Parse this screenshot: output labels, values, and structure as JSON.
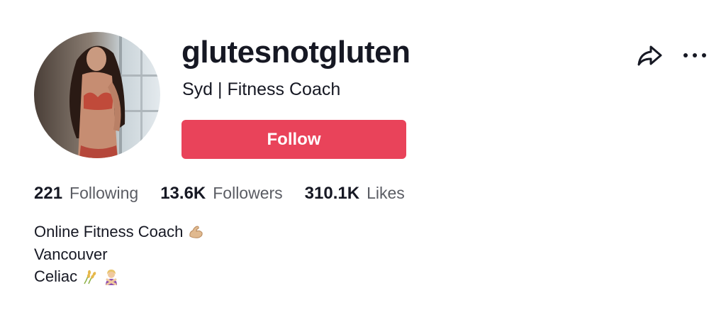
{
  "profile": {
    "username": "glutesnotgluten",
    "nickname": "Syd | Fitness Coach",
    "follow_label": "Follow"
  },
  "stats": [
    {
      "value": "221",
      "label": "Following"
    },
    {
      "value": "13.6K",
      "label": "Followers"
    },
    {
      "value": "310.1K",
      "label": "Likes"
    }
  ],
  "bio": {
    "line1": "Online Fitness Coach",
    "line1_emoji": "flexed-biceps-emoji",
    "line2": "Vancouver",
    "line3": "Celiac",
    "line3_emojis": [
      "wheat-emoji",
      "person-gesturing-no-emoji"
    ]
  },
  "colors": {
    "accent": "#e9435a",
    "text": "#161823",
    "secondary_text": "#5a5c63"
  },
  "icons": {
    "share": "share-arrow-icon",
    "more": "more-options-icon"
  }
}
